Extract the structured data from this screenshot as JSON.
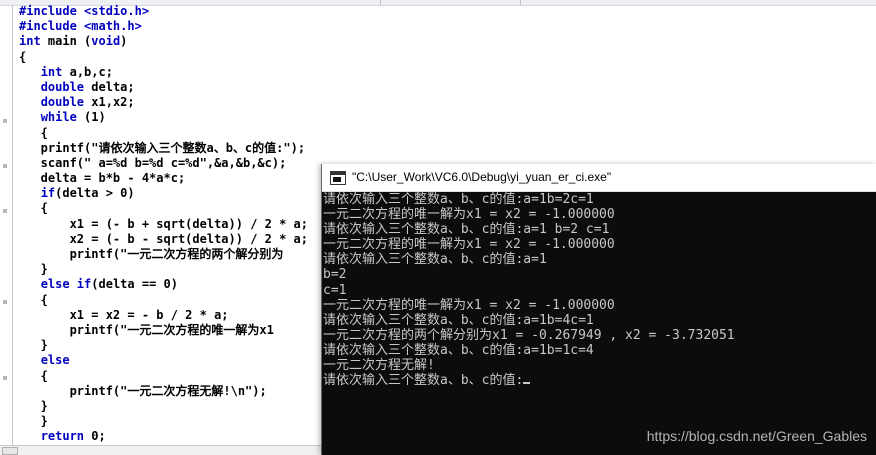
{
  "editor": {
    "lines": [
      [
        {
          "t": "#include <stdio.h>",
          "k": true
        }
      ],
      [
        {
          "t": "#include <math.h>",
          "k": true
        }
      ],
      [
        {
          "t": "int",
          "k": true
        },
        {
          "t": " main ("
        },
        {
          "t": "void",
          "k": true
        },
        {
          "t": ")"
        }
      ],
      [
        {
          "t": "{"
        }
      ],
      [
        {
          "t": "   "
        },
        {
          "t": "int",
          "k": true
        },
        {
          "t": " a,b,c;"
        }
      ],
      [
        {
          "t": "   "
        },
        {
          "t": "double",
          "k": true
        },
        {
          "t": " delta;"
        }
      ],
      [
        {
          "t": "   "
        },
        {
          "t": "double",
          "k": true
        },
        {
          "t": " x1,x2;"
        }
      ],
      [
        {
          "t": "   "
        },
        {
          "t": "while",
          "k": true
        },
        {
          "t": " (1)"
        }
      ],
      [
        {
          "t": "   {"
        }
      ],
      [
        {
          "t": "   printf(\"请依次输入三个整数a、b、c的值:\");"
        }
      ],
      [
        {
          "t": "   scanf(\" a=%d b=%d c=%d\",&a,&b,&c);"
        }
      ],
      [
        {
          "t": "   delta = b*b - 4*a*c;"
        }
      ],
      [
        {
          "t": "   "
        },
        {
          "t": "if",
          "k": true
        },
        {
          "t": "(delta > 0)"
        }
      ],
      [
        {
          "t": "   {"
        }
      ],
      [
        {
          "t": "       x1 = (- b + sqrt(delta)) / 2 * a;"
        }
      ],
      [
        {
          "t": "       x2 = (- b - sqrt(delta)) / 2 * a;"
        }
      ],
      [
        {
          "t": "       printf(\"一元二次方程的两个解分别为"
        }
      ],
      [
        {
          "t": "   }"
        }
      ],
      [
        {
          "t": "   "
        },
        {
          "t": "else if",
          "k": true
        },
        {
          "t": "(delta == 0)"
        }
      ],
      [
        {
          "t": "   {"
        }
      ],
      [
        {
          "t": "       x1 = x2 = - b / 2 * a;"
        }
      ],
      [
        {
          "t": "       printf(\"一元二次方程的唯一解为x1"
        }
      ],
      [
        {
          "t": "   }"
        }
      ],
      [
        {
          "t": "   "
        },
        {
          "t": "else",
          "k": true
        }
      ],
      [
        {
          "t": "   {"
        }
      ],
      [
        {
          "t": "       printf(\"一元二次方程无解!\\n\");"
        }
      ],
      [
        {
          "t": "   }"
        }
      ],
      [
        {
          "t": "   }"
        }
      ],
      [
        {
          "t": "   "
        },
        {
          "t": "return",
          "k": true
        },
        {
          "t": " 0;"
        }
      ]
    ]
  },
  "console": {
    "title": "\"C:\\User_Work\\VC6.0\\Debug\\yi_yuan_er_ci.exe\"",
    "lines": [
      "请依次输入三个整数a、b、c的值:a=1b=2c=1",
      "一元二次方程的唯一解为x1 = x2 = -1.000000",
      "请依次输入三个整数a、b、c的值:a=1 b=2 c=1",
      "一元二次方程的唯一解为x1 = x2 = -1.000000",
      "请依次输入三个整数a、b、c的值:a=1",
      "b=2",
      "c=1",
      "一元二次方程的唯一解为x1 = x2 = -1.000000",
      "请依次输入三个整数a、b、c的值:a=1b=4c=1",
      "一元二次方程的两个解分别为x1 = -0.267949 , x2 = -3.732051",
      "请依次输入三个整数a、b、c的值:a=1b=1c=4",
      "一元二次方程无解!",
      "请依次输入三个整数a、b、c的值:"
    ]
  },
  "watermark": "https://blog.csdn.net/Green_Gables",
  "colors": {
    "keyword": "#0000c0",
    "console_bg": "#0c0c0c",
    "console_text": "#c8c8c8"
  }
}
